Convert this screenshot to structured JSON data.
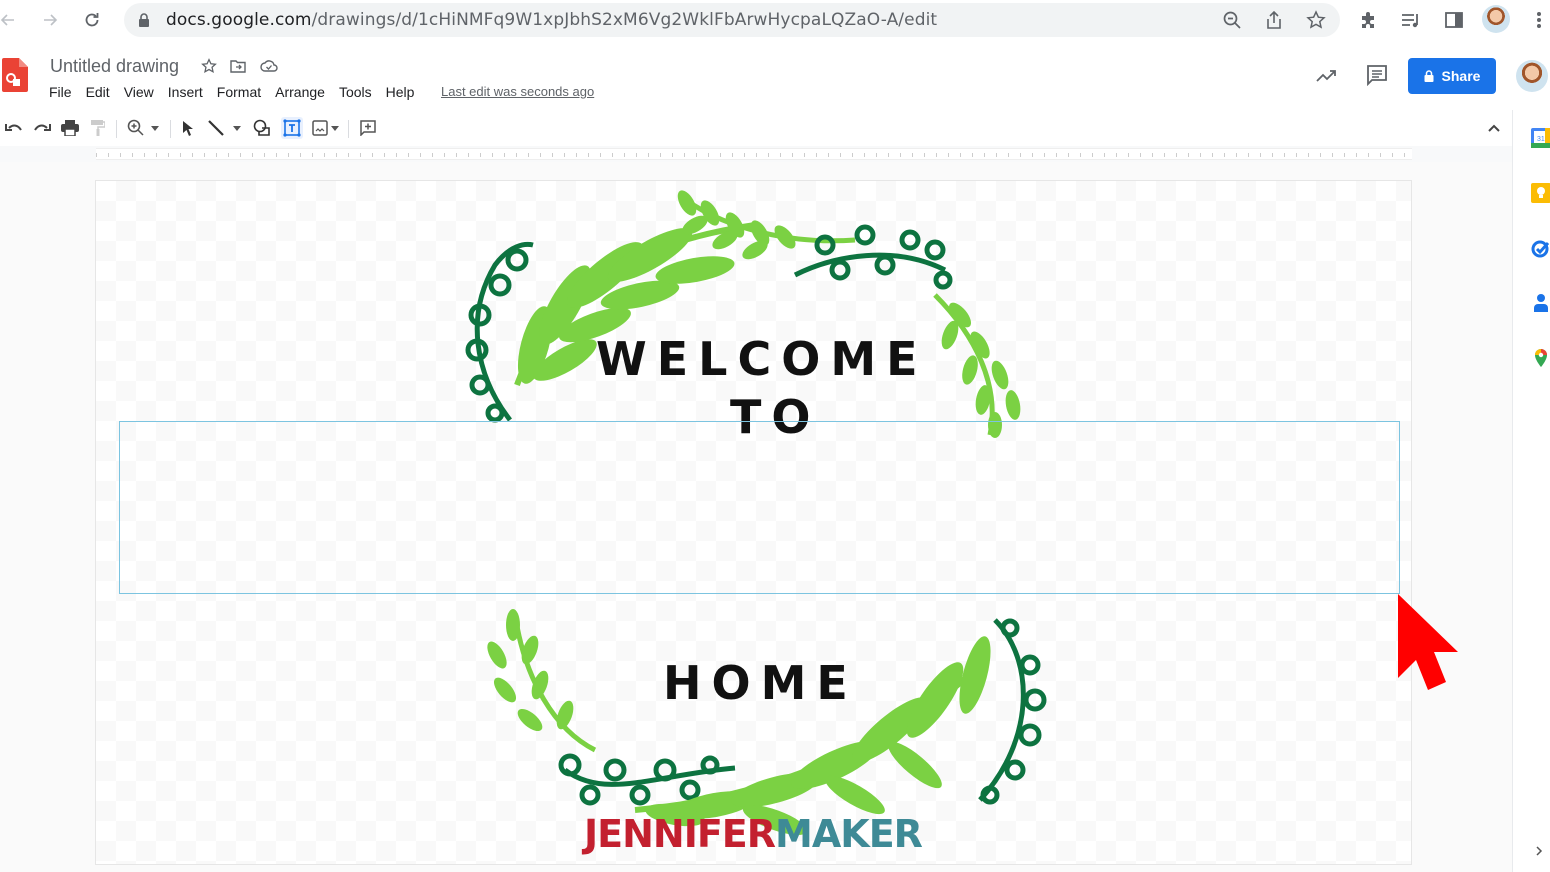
{
  "browser": {
    "url_host": "docs.google.com",
    "url_path": "/drawings/d/1cHiNMFq9W1xpJbhS2xM6Vg2WklFbArwHycpaLQZaO-A/edit",
    "icons": [
      "back-icon",
      "forward-icon",
      "reload-icon",
      "lock-icon",
      "zoom-icon",
      "share-page-icon",
      "bookmark-star-icon",
      "extensions-icon",
      "media-control-icon",
      "side-panel-icon",
      "profile-avatar",
      "more-menu-icon"
    ]
  },
  "app": {
    "title": "Untitled drawing",
    "menu": [
      "File",
      "Edit",
      "View",
      "Insert",
      "Format",
      "Arrange",
      "Tools",
      "Help"
    ],
    "last_edit": "Last edit was seconds ago",
    "share_label": "Share",
    "accent_color": "#1a73e8"
  },
  "toolbar": {
    "tools": [
      "undo",
      "redo",
      "print",
      "paint-format",
      "zoom",
      "select",
      "line",
      "shape",
      "text-box",
      "image",
      "comment"
    ],
    "active_tool": "text-box"
  },
  "canvas": {
    "welcome_text": "WELCOME",
    "to_text": "TO",
    "home_text": "HOME",
    "watermark_left": "JENNIFER",
    "watermark_right": "MAKER",
    "watermark_left_color": "#c3202f",
    "watermark_right_color": "#3e8a96",
    "leaf_color": "#7bd143",
    "vine_color": "#0d7340",
    "selection_color": "#7cc4e0",
    "cursor_color": "#ff0000"
  },
  "side_panel": {
    "items": [
      "calendar",
      "keep",
      "tasks",
      "contacts",
      "maps"
    ],
    "calendar_day": "31"
  }
}
